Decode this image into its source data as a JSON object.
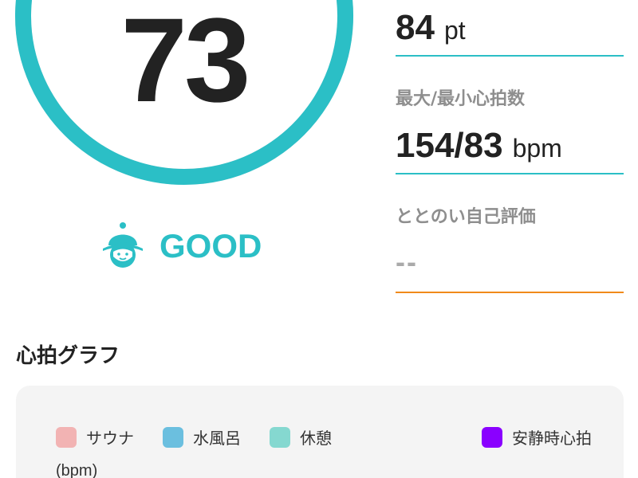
{
  "score": {
    "value": "73",
    "progress_percent": 82,
    "ring_color": "#2bbfc6",
    "track_color": "#dcdcdc"
  },
  "rating": {
    "icon": "sauna-hat-face-icon",
    "label": "GOOD",
    "color": "#2bbfc6"
  },
  "stats": {
    "points": {
      "value": "84",
      "unit": "pt"
    },
    "heart_rate": {
      "label": "最大/最小心拍数",
      "value": "154/83",
      "unit": "bpm"
    },
    "self_eval": {
      "label": "ととのい自己評価",
      "value": "--"
    }
  },
  "graph": {
    "title": "心拍グラフ",
    "legend": [
      {
        "label": "サウナ",
        "color": "#f2b3b3"
      },
      {
        "label": "水風呂",
        "color": "#6bbfdf"
      },
      {
        "label": "休憩",
        "color": "#85d8d0"
      },
      {
        "label": "安静時心拍",
        "color": "#8a00ff"
      }
    ],
    "y_unit": "(bpm)"
  }
}
